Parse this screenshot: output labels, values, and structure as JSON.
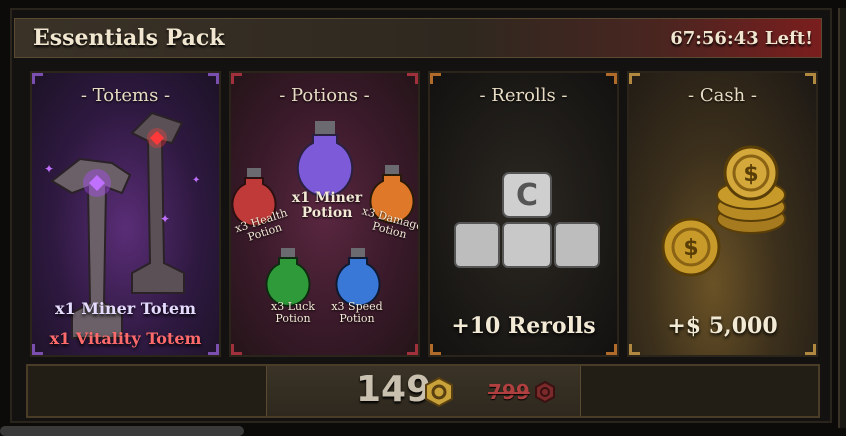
{
  "pack": {
    "title": "Essentials Pack",
    "timer": "67:56:43 Left!"
  },
  "cards": {
    "totems": {
      "title": "- Totems -",
      "items": [
        "x1 Miner Totem",
        "x1 Vitality Totem"
      ]
    },
    "potions": {
      "title": "- Potions -",
      "miner": [
        "x1 Miner",
        "Potion"
      ],
      "health": [
        "x3 Health",
        "Potion"
      ],
      "damage": [
        "x3 Damage",
        "Potion"
      ],
      "luck": [
        "x3 Luck",
        "Potion"
      ],
      "speed": [
        "x3 Speed",
        "Potion"
      ]
    },
    "rerolls": {
      "title": "- Rerolls -",
      "label": "+10 Rerolls",
      "icon": "reroll-keys-icon"
    },
    "cash": {
      "title": "- Cash -",
      "label": "+$ 5,000",
      "icon": "coin-stack-icon"
    }
  },
  "purchase": {
    "price": "149",
    "old_price": "799",
    "currency_icon": "robux-icon"
  },
  "colors": {
    "totems_accent": "#7a4fb0",
    "potions_accent": "#a0303c",
    "rerolls_accent": "#b06a2a",
    "cash_accent": "#b08840",
    "old_price": "#b04040",
    "vitality_text": "#ff6b6b"
  }
}
